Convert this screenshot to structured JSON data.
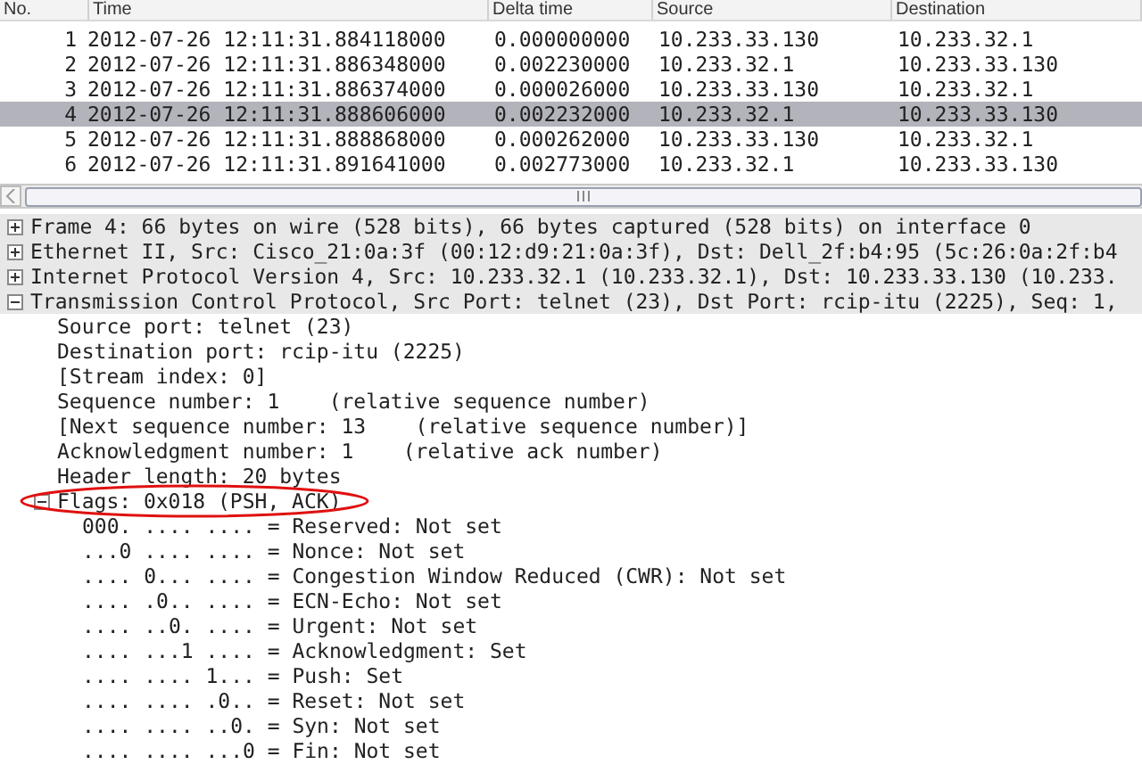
{
  "packet_list": {
    "columns": [
      "No.",
      "Time",
      "Delta time",
      "Source",
      "Destination"
    ],
    "rows": [
      {
        "no": "1",
        "time": "2012-07-26 12:11:31.884118000",
        "delta": "0.000000000",
        "source": "10.233.33.130",
        "destination": "10.233.32.1",
        "selected": false
      },
      {
        "no": "2",
        "time": "2012-07-26 12:11:31.886348000",
        "delta": "0.002230000",
        "source": "10.233.32.1",
        "destination": "10.233.33.130",
        "selected": false
      },
      {
        "no": "3",
        "time": "2012-07-26 12:11:31.886374000",
        "delta": "0.000026000",
        "source": "10.233.33.130",
        "destination": "10.233.32.1",
        "selected": false
      },
      {
        "no": "4",
        "time": "2012-07-26 12:11:31.888606000",
        "delta": "0.002232000",
        "source": "10.233.32.1",
        "destination": "10.233.33.130",
        "selected": true
      },
      {
        "no": "5",
        "time": "2012-07-26 12:11:31.888868000",
        "delta": "0.000262000",
        "source": "10.233.33.130",
        "destination": "10.233.32.1",
        "selected": false
      },
      {
        "no": "6",
        "time": "2012-07-26 12:11:31.891641000",
        "delta": "0.002773000",
        "source": "10.233.32.1",
        "destination": "10.233.33.130",
        "selected": false
      }
    ]
  },
  "details": [
    {
      "text": "Frame 4: 66 bytes on wire (528 bits), 66 bytes captured (528 bits) on interface 0",
      "expanded": false
    },
    {
      "text": "Ethernet II, Src: Cisco_21:0a:3f (00:12:d9:21:0a:3f), Dst: Dell_2f:b4:95 (5c:26:0a:2f:b4",
      "expanded": false
    },
    {
      "text": "Internet Protocol Version 4, Src: 10.233.32.1 (10.233.32.1), Dst: 10.233.33.130 (10.233.",
      "expanded": false
    },
    {
      "text": "Transmission Control Protocol, Src Port: telnet (23), Dst Port: rcip-itu (2225), Seq: 1,",
      "expanded": true,
      "children": [
        {
          "text": "Source port: telnet (23)"
        },
        {
          "text": "Destination port: rcip-itu (2225)"
        },
        {
          "text": "[Stream index: 0]"
        },
        {
          "text": "Sequence number: 1    (relative sequence number)"
        },
        {
          "text": "[Next sequence number: 13    (relative sequence number)]"
        },
        {
          "text": "Acknowledgment number: 1    (relative ack number)"
        },
        {
          "text": "Header length: 20 bytes"
        },
        {
          "text": "Flags: 0x018 (PSH, ACK)",
          "expanded": true,
          "circled": true,
          "children": [
            {
              "text": "000. .... .... = Reserved: Not set"
            },
            {
              "text": "...0 .... .... = Nonce: Not set"
            },
            {
              "text": ".... 0... .... = Congestion Window Reduced (CWR): Not set"
            },
            {
              "text": ".... .0.. .... = ECN-Echo: Not set"
            },
            {
              "text": ".... ..0. .... = Urgent: Not set"
            },
            {
              "text": ".... ...1 .... = Acknowledgment: Set"
            },
            {
              "text": ".... .... 1... = Push: Set"
            },
            {
              "text": ".... .... .0.. = Reset: Not set"
            },
            {
              "text": ".... .... ..0. = Syn: Not set"
            },
            {
              "text": ".... .... ...0 = Fin: Not set"
            }
          ]
        }
      ]
    }
  ]
}
